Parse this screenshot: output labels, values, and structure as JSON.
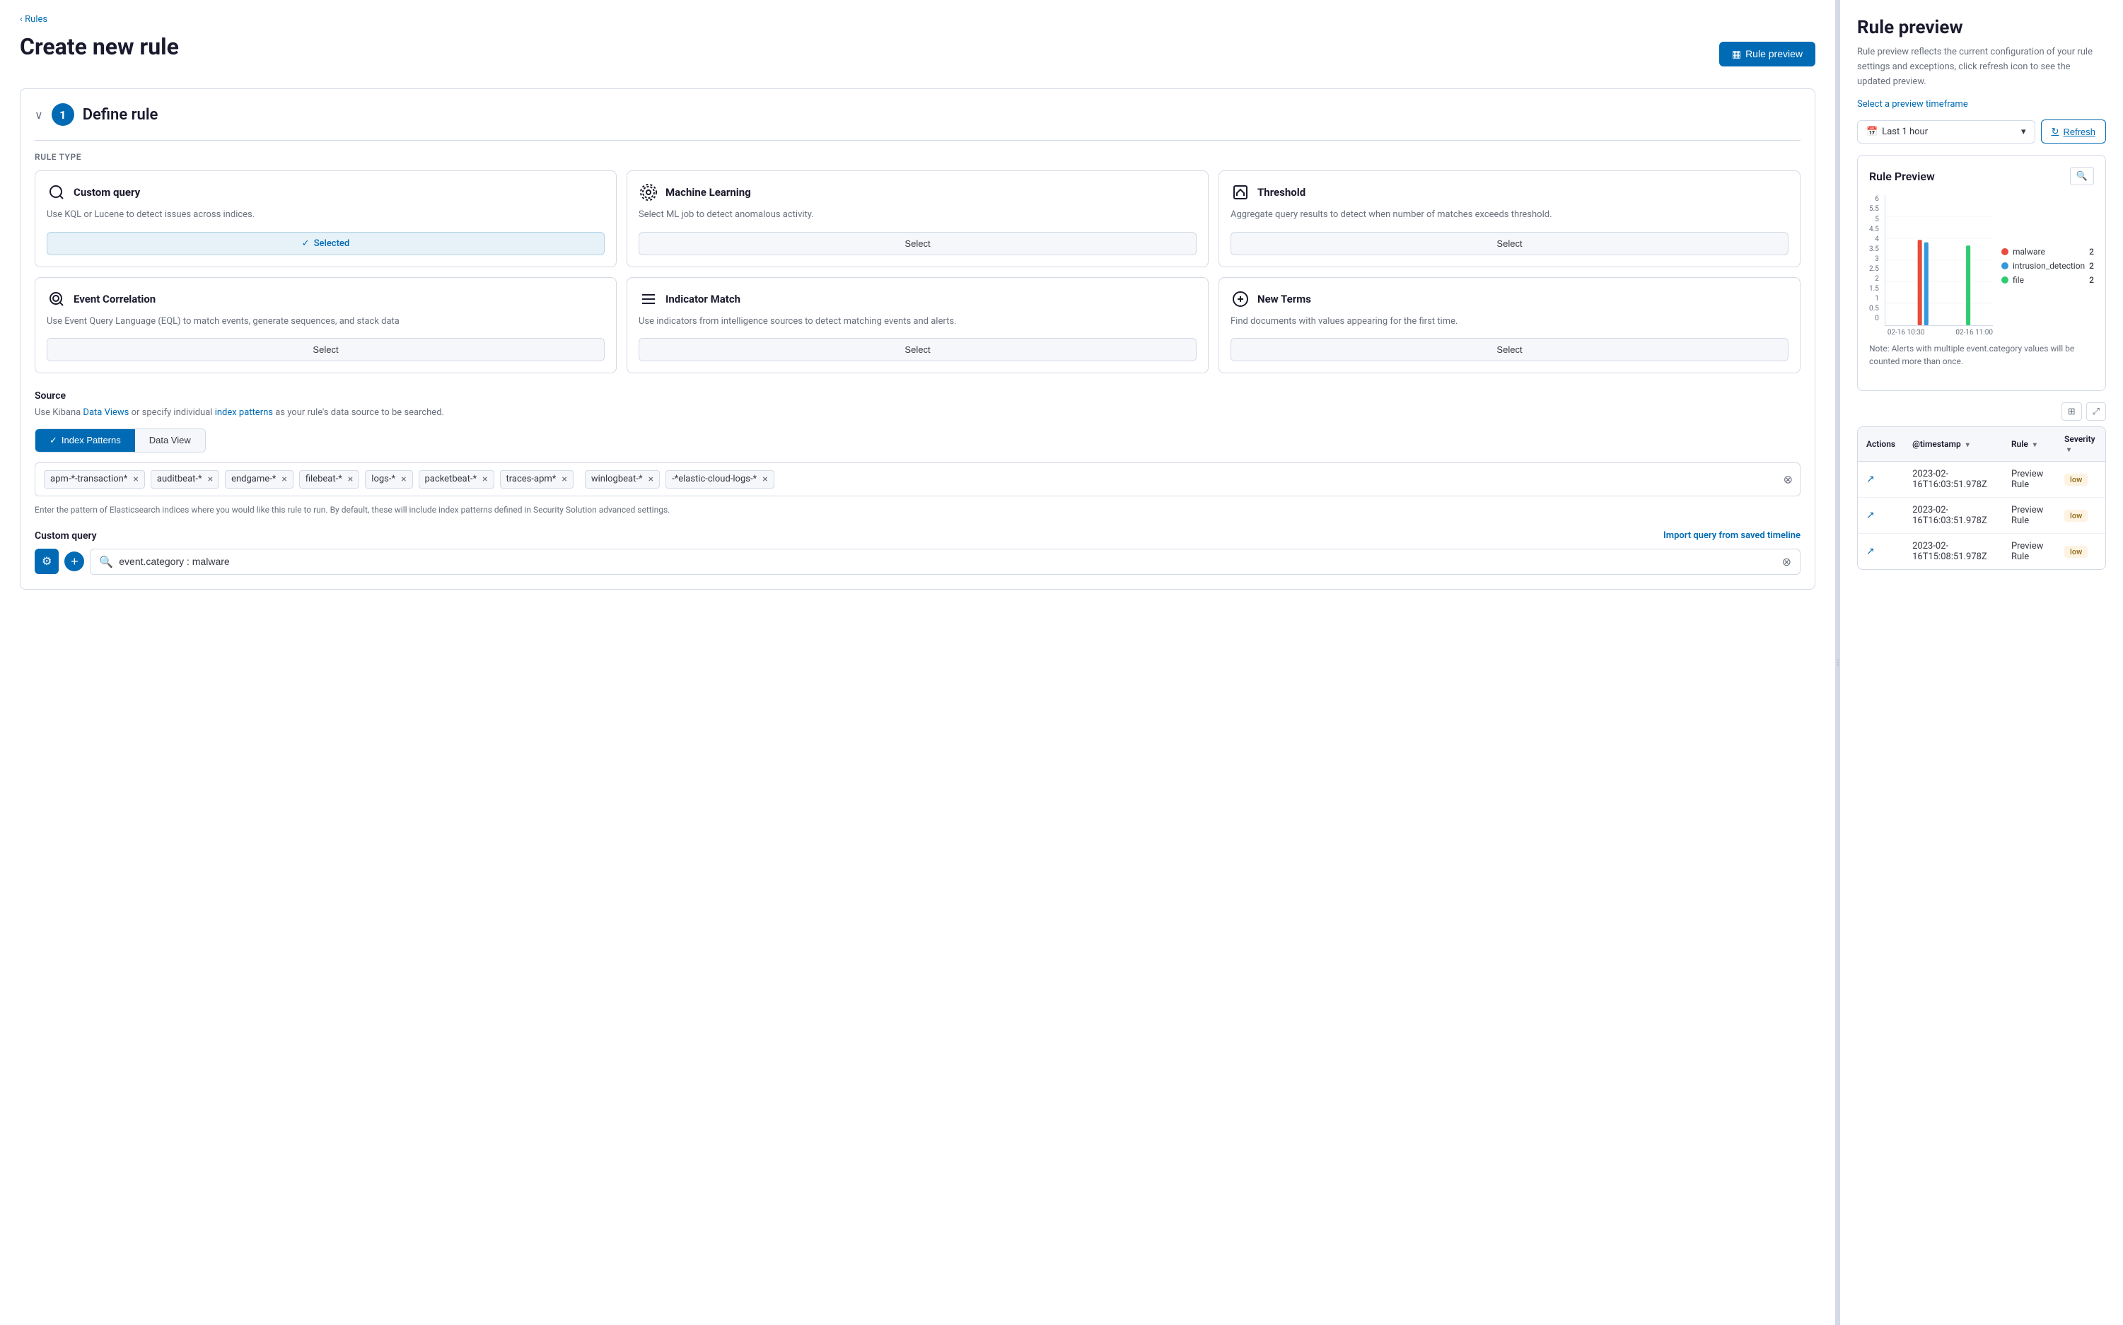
{
  "breadcrumb": "Rules",
  "page_title": "Create new rule",
  "rule_preview_btn": "Rule preview",
  "section1": {
    "step": "1",
    "title": "Define rule",
    "rule_type_label": "Rule type",
    "rule_types": [
      {
        "id": "custom_query",
        "icon": "○",
        "name": "Custom query",
        "desc": "Use KQL or Lucene to detect issues across indices.",
        "button_text": "Selected",
        "selected": true
      },
      {
        "id": "machine_learning",
        "icon": "⚙",
        "name": "Machine Learning",
        "desc": "Select ML job to detect anomalous activity.",
        "button_text": "Select",
        "selected": false
      },
      {
        "id": "threshold",
        "icon": "◱",
        "name": "Threshold",
        "desc": "Aggregate query results to detect when number of matches exceeds threshold.",
        "button_text": "Select",
        "selected": false
      },
      {
        "id": "event_correlation",
        "icon": "⊕",
        "name": "Event Correlation",
        "desc": "Use Event Query Language (EQL) to match events, generate sequences, and stack data",
        "button_text": "Select",
        "selected": false
      },
      {
        "id": "indicator_match",
        "icon": "≡",
        "name": "Indicator Match",
        "desc": "Use indicators from intelligence sources to detect matching events and alerts.",
        "button_text": "Select",
        "selected": false
      },
      {
        "id": "new_terms",
        "icon": "+",
        "name": "New Terms",
        "desc": "Find documents with values appearing for the first time.",
        "button_text": "Select",
        "selected": false
      }
    ]
  },
  "source": {
    "label": "Source",
    "desc_before": "Use Kibana ",
    "data_views_link": "Data Views",
    "desc_middle": " or specify individual ",
    "index_patterns_link": "index patterns",
    "desc_after": " as your rule's data source to be searched.",
    "tabs": [
      {
        "label": "Index Patterns",
        "active": true
      },
      {
        "label": "Data View",
        "active": false
      }
    ],
    "index_tags": [
      "apm-*-transaction*",
      "auditbeat-*",
      "endgame-*",
      "filebeat-*",
      "logs-*",
      "packetbeat-*",
      "traces-apm*",
      "winlogbeat-*",
      "-*elastic-cloud-logs-*"
    ],
    "hint": "Enter the pattern of Elasticsearch indices where you would like this rule to run. By default, these will include index patterns defined in Security Solution advanced settings."
  },
  "custom_query": {
    "label": "Custom query",
    "import_link": "Import query from saved timeline",
    "value": "event.category : malware"
  },
  "side_panel": {
    "title": "Rule preview",
    "desc": "Rule preview reflects the current configuration of your rule settings and exceptions, click refresh icon to see the updated preview.",
    "timeframe_link": "Select a preview timeframe",
    "timeframe_value": "Last 1 hour",
    "refresh_btn": "Refresh",
    "chart_title": "Rule Preview",
    "chart_note": "Note: Alerts with multiple event.category values will be counted more than once.",
    "legend": [
      {
        "label": "malware",
        "color": "#e74c3c",
        "count": "2"
      },
      {
        "label": "intrusion_detection",
        "color": "#3498db",
        "count": "2"
      },
      {
        "label": "file",
        "color": "#2ecc71",
        "count": "2"
      }
    ],
    "x_labels": [
      "02-16 10:30",
      "02-16 11:00"
    ],
    "y_labels": [
      "6",
      "5.5",
      "5",
      "4.5",
      "4",
      "3.5",
      "3",
      "2.5",
      "2",
      "1.5",
      "1",
      "0.5",
      "0"
    ],
    "table": {
      "columns": [
        {
          "label": "Actions"
        },
        {
          "label": "@timestamp",
          "sortable": true
        },
        {
          "label": "Rule",
          "sortable": true
        },
        {
          "label": "Severity",
          "sortable": true
        }
      ],
      "rows": [
        {
          "timestamp": "2023-02-16T16:03:51.978Z",
          "rule": "Preview Rule",
          "severity": "low"
        },
        {
          "timestamp": "2023-02-16T16:03:51.978Z",
          "rule": "Preview Rule",
          "severity": "low"
        },
        {
          "timestamp": "2023-02-16T15:08:51.978Z",
          "rule": "Preview Rule",
          "severity": "low"
        }
      ]
    }
  }
}
